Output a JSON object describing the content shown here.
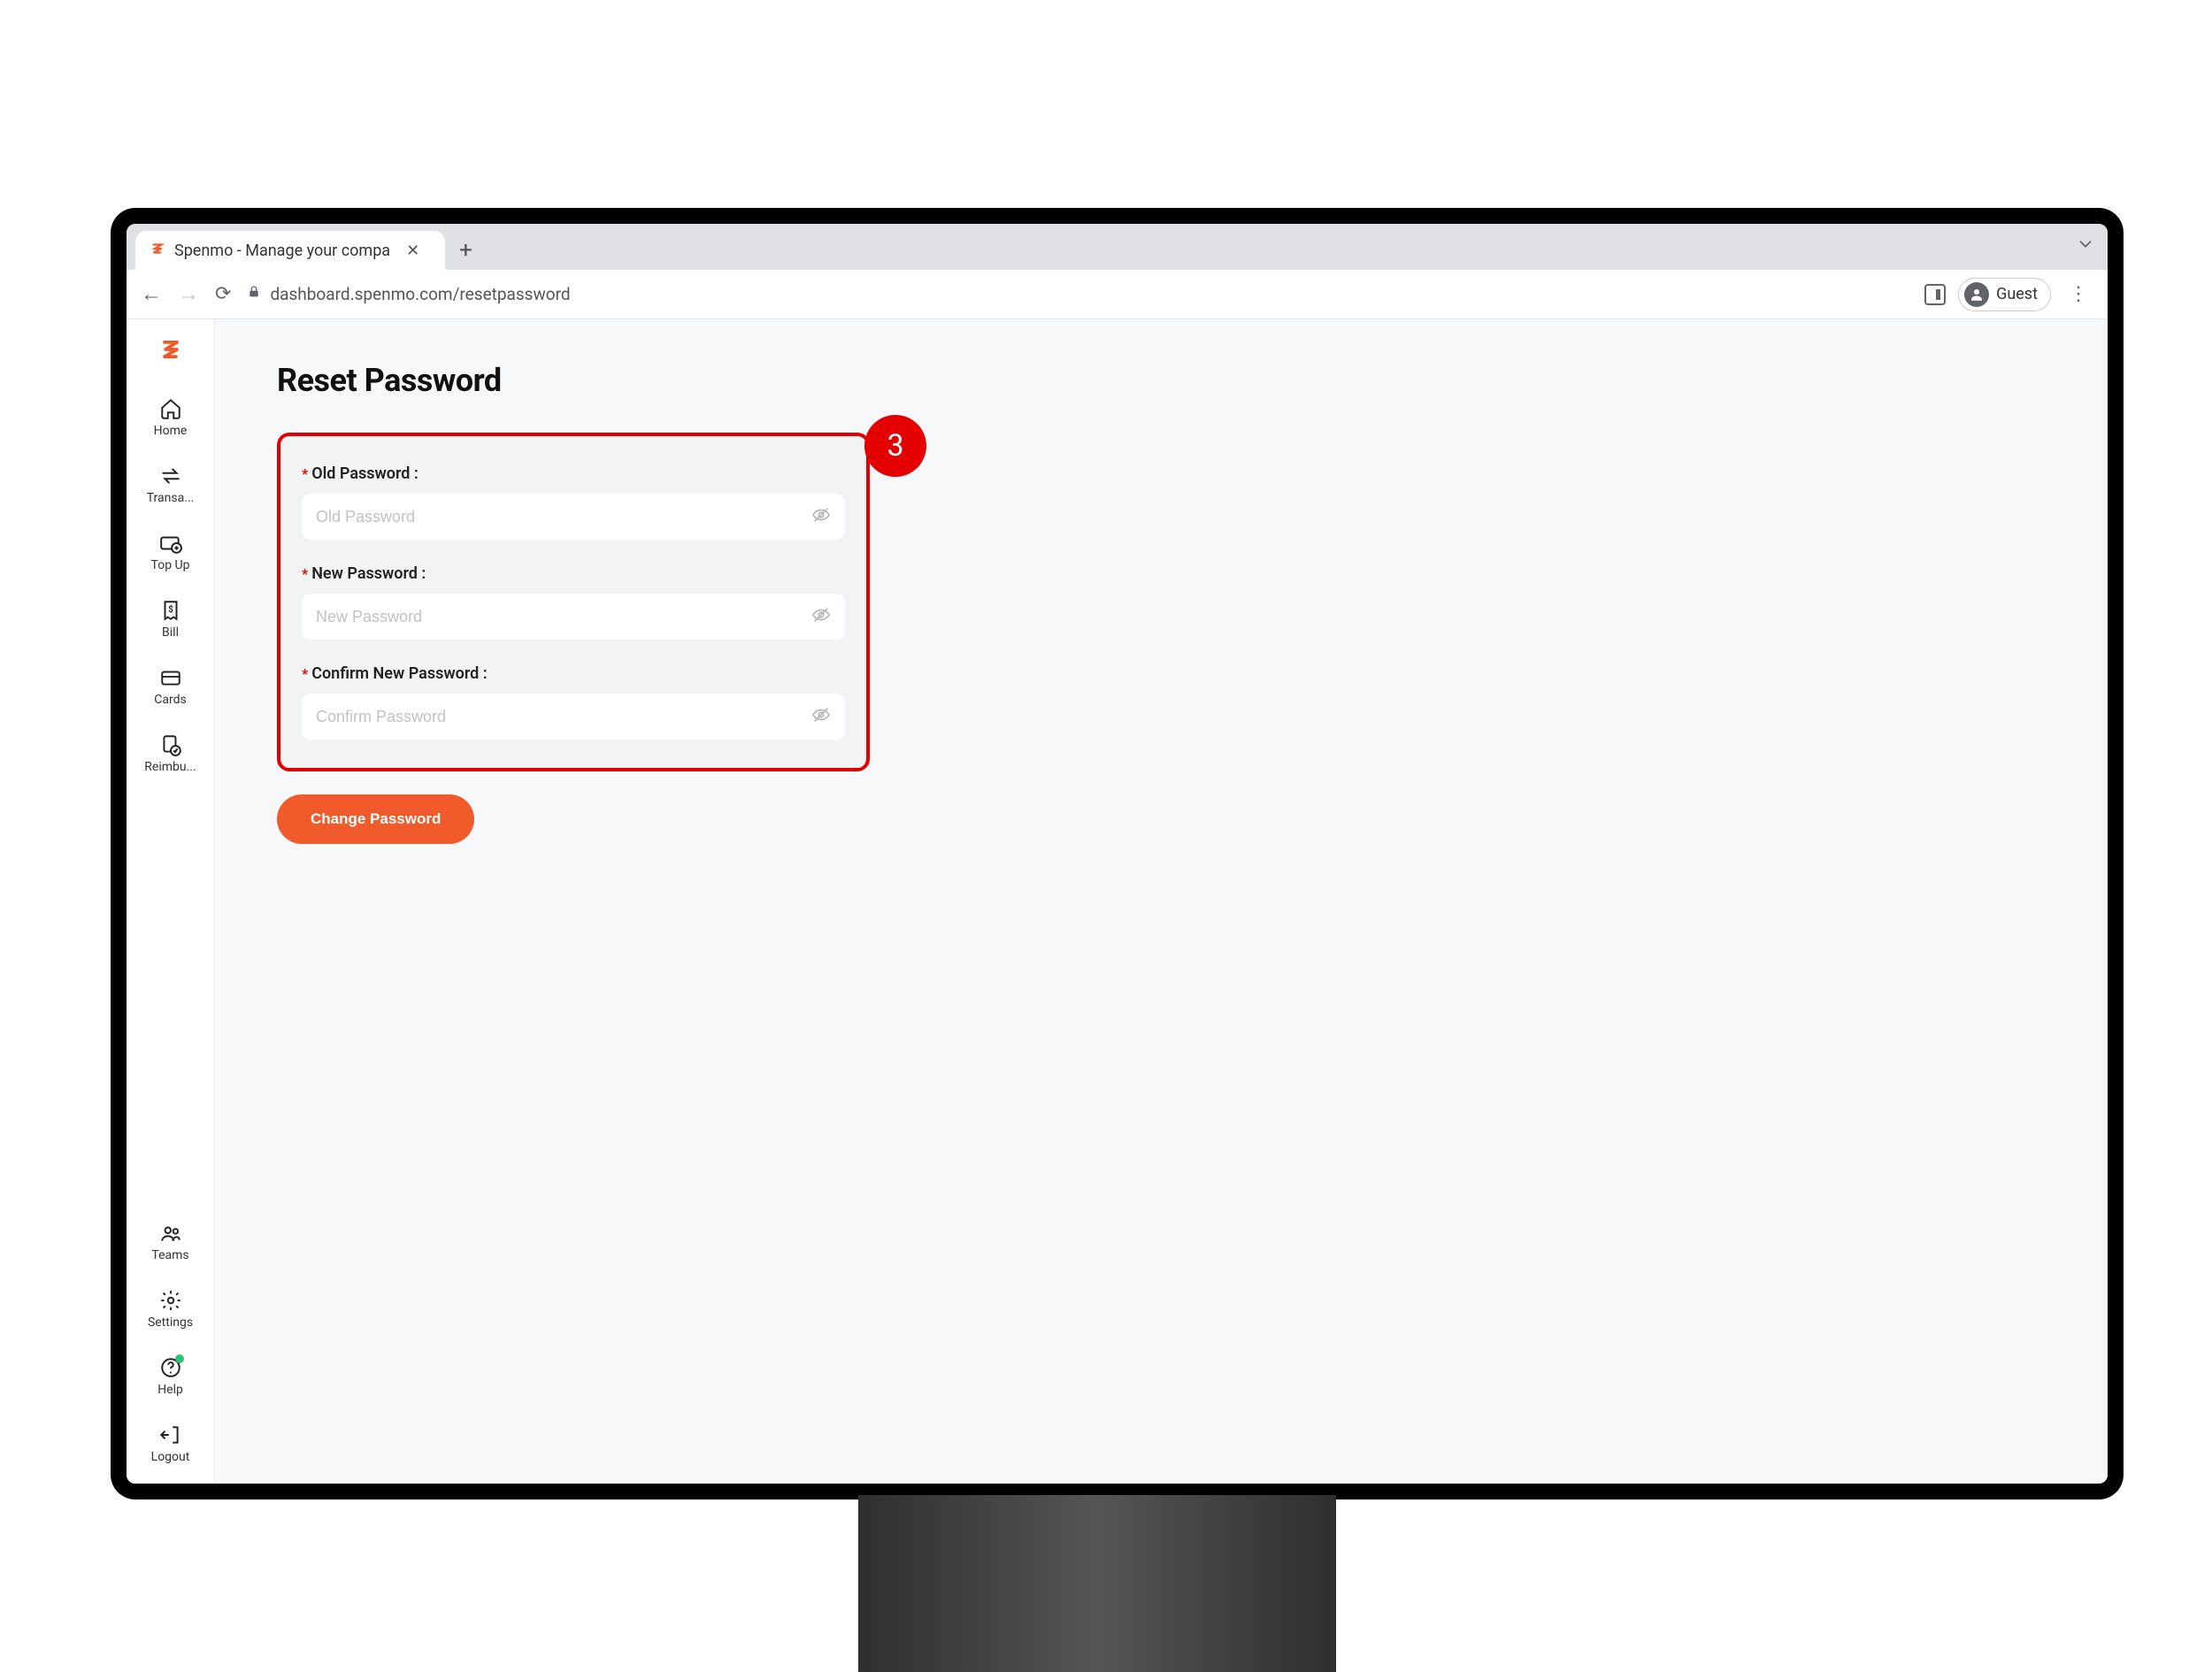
{
  "browser": {
    "tab_title": "Spenmo - Manage your compa",
    "url": "dashboard.spenmo.com/resetpassword",
    "guest_label": "Guest"
  },
  "sidebar": {
    "items_top": [
      {
        "label": "Home"
      },
      {
        "label": "Transa..."
      },
      {
        "label": "Top Up"
      },
      {
        "label": "Bill"
      },
      {
        "label": "Cards"
      },
      {
        "label": "Reimbu..."
      }
    ],
    "items_bottom": [
      {
        "label": "Teams"
      },
      {
        "label": "Settings"
      },
      {
        "label": "Help"
      },
      {
        "label": "Logout"
      }
    ]
  },
  "page": {
    "title": "Reset Password",
    "fields": {
      "old": {
        "label": "Old Password :",
        "placeholder": "Old Password"
      },
      "new": {
        "label": "New Password :",
        "placeholder": "New Password"
      },
      "confirm": {
        "label": "Confirm New Password :",
        "placeholder": "Confirm Password"
      }
    },
    "submit_label": "Change Password"
  },
  "annotation": {
    "number": "3"
  }
}
